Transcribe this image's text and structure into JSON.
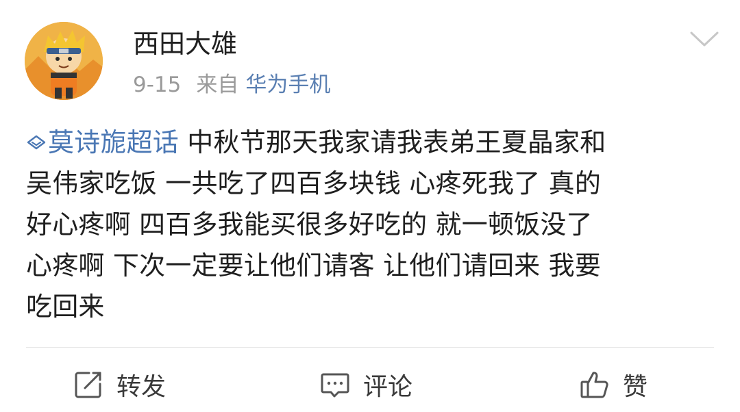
{
  "post": {
    "username": "西田大雄",
    "date": "9-15",
    "source_prefix": "来自",
    "source_device": "华为手机",
    "topic": "莫诗旎超话",
    "lines": [
      " 中秋节那天我家请我表弟王夏晶家和",
      "吴伟家吃饭 一共吃了四百多块钱 心疼死我了 真的",
      "好心疼啊 四百多我能买很多好吃的 就一顿饭没了",
      "心疼啊 下次一定要让他们请客 让他们请回来 我要",
      "吃回来"
    ]
  },
  "actions": {
    "repost_label": "转发",
    "comment_label": "评论",
    "like_label": "赞"
  },
  "icons": {
    "avatar": "cartoon-ninja-avatar",
    "menu": "chevron-down-icon",
    "topic": "diamond-topic-icon",
    "repost": "repost-icon",
    "comment": "comment-icon",
    "like": "thumbs-up-icon"
  },
  "colors": {
    "link": "#4a77b4",
    "meta": "#9a9a9a",
    "device": "#5a7fb2",
    "avatar_bg": "#e9a23a"
  }
}
